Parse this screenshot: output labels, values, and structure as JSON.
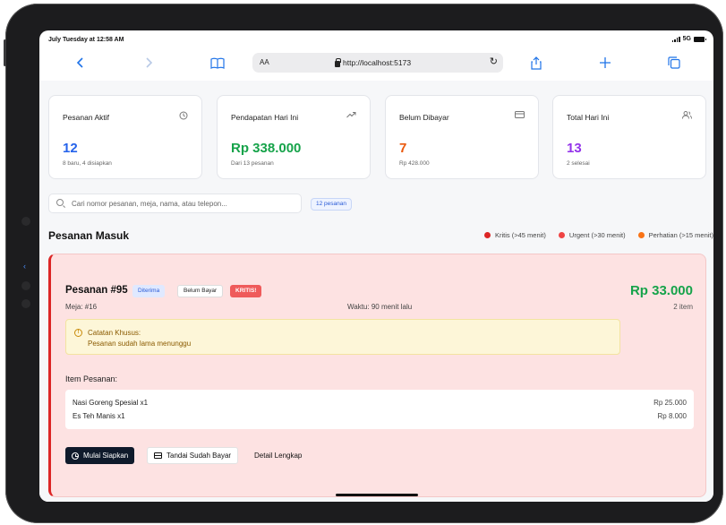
{
  "status_bar": {
    "time": "July Tuesday at 12:58 AM",
    "network": "5G"
  },
  "browser": {
    "aa_label": "AA",
    "url": "http://localhost:5173",
    "icons": [
      "chevron-left-icon",
      "chevron-right-icon",
      "book-icon",
      "share-icon",
      "plus-icon",
      "tabs-icon",
      "reload-icon",
      "lock-icon"
    ]
  },
  "stats": [
    {
      "label": "Pesanan Aktif",
      "value": "12",
      "sub": "8 baru, 4 disiapkan",
      "icon": "clock-icon",
      "color": "#2563eb"
    },
    {
      "label": "Pendapatan Hari Ini",
      "value": "Rp 338.000",
      "sub": "Dari 13 pesanan",
      "icon": "trending-up-icon",
      "color": "#16a34a"
    },
    {
      "label": "Belum Dibayar",
      "value": "7",
      "sub": "Rp 428.000",
      "icon": "credit-card-icon",
      "color": "#ea580c"
    },
    {
      "label": "Total Hari Ini",
      "value": "13",
      "sub": "2 selesai",
      "icon": "users-icon",
      "color": "#9333ea"
    }
  ],
  "search": {
    "placeholder": "Cari nomor pesanan, meja, nama, atau telepon...",
    "count_badge": "12 pesanan"
  },
  "section": {
    "title": "Pesanan Masuk"
  },
  "legend": [
    {
      "label": "Kritis (>45 menit)",
      "color": "#dc2626"
    },
    {
      "label": "Urgent (>30 menit)",
      "color": "#ef4444"
    },
    {
      "label": "Perhatian (>15 menit)",
      "color": "#f97316"
    }
  ],
  "order": {
    "title": "Pesanan #95",
    "status_badge": "Diterima",
    "payment_badge": "Belum Bayar",
    "urgency_badge": "KRITIS!",
    "table": "Meja: #16",
    "time": "Waktu: 90 menit lalu",
    "total": "Rp 33.000",
    "items_count": "2 item",
    "note_title": "Catatan Khusus:",
    "note_text": "Pesanan sudah lama menunggu",
    "items_heading": "Item Pesanan:",
    "items": [
      {
        "name": "Nasi Goreng Spesial x1",
        "price": "Rp 25.000"
      },
      {
        "name": "Es Teh Manis x1",
        "price": "Rp 8.000"
      }
    ],
    "actions": {
      "start": "Mulai Siapkan",
      "mark_paid": "Tandai Sudah Bayar",
      "details": "Detail Lengkap"
    }
  }
}
